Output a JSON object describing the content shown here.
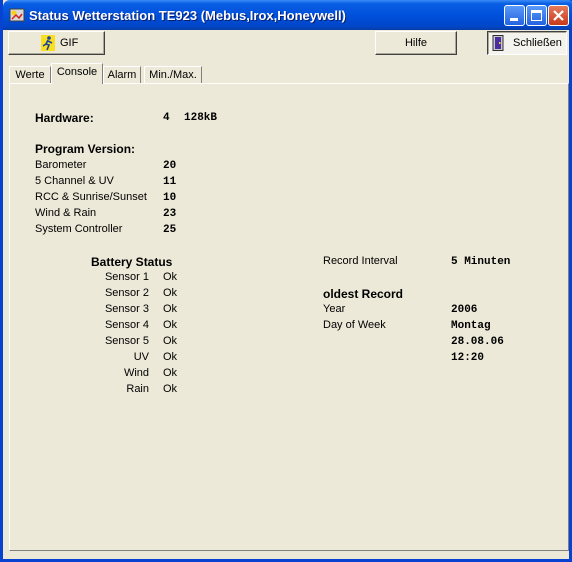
{
  "window": {
    "title": "Status Wetterstation TE923 (Mebus,Irox,Honeywell)"
  },
  "toolbar": {
    "gif_label": "GIF",
    "help_label": "Hilfe",
    "close_label": "Schließen"
  },
  "tabs": [
    {
      "label": "Werte"
    },
    {
      "label": "Console"
    },
    {
      "label": "Alarm"
    },
    {
      "label": "Min./Max."
    }
  ],
  "hardware": {
    "label": "Hardware:",
    "value1": "4",
    "value2": "128kB"
  },
  "program_version": {
    "heading": "Program Version:",
    "rows": [
      {
        "label": "Barometer",
        "value": "20"
      },
      {
        "label": "5 Channel & UV",
        "value": "11"
      },
      {
        "label": "RCC & Sunrise/Sunset",
        "value": "10"
      },
      {
        "label": "Wind & Rain",
        "value": "23"
      },
      {
        "label": "System Controller",
        "value": "25"
      }
    ]
  },
  "battery": {
    "heading": "Battery Status",
    "rows": [
      {
        "label": "Sensor 1",
        "value": "Ok"
      },
      {
        "label": "Sensor 2",
        "value": "Ok"
      },
      {
        "label": "Sensor 3",
        "value": "Ok"
      },
      {
        "label": "Sensor 4",
        "value": "Ok"
      },
      {
        "label": "Sensor 5",
        "value": "Ok"
      },
      {
        "label": "UV",
        "value": "Ok"
      },
      {
        "label": "Wind",
        "value": "Ok"
      },
      {
        "label": "Rain",
        "value": "Ok"
      }
    ]
  },
  "record": {
    "interval_label": "Record Interval",
    "interval_value": "5 Minuten",
    "oldest_heading": "oldest Record",
    "year_label": "Year",
    "year_value": "2006",
    "dow_label": "Day of Week",
    "dow_value": "Montag",
    "date_value": "28.08.06",
    "time_value": "12:20"
  }
}
